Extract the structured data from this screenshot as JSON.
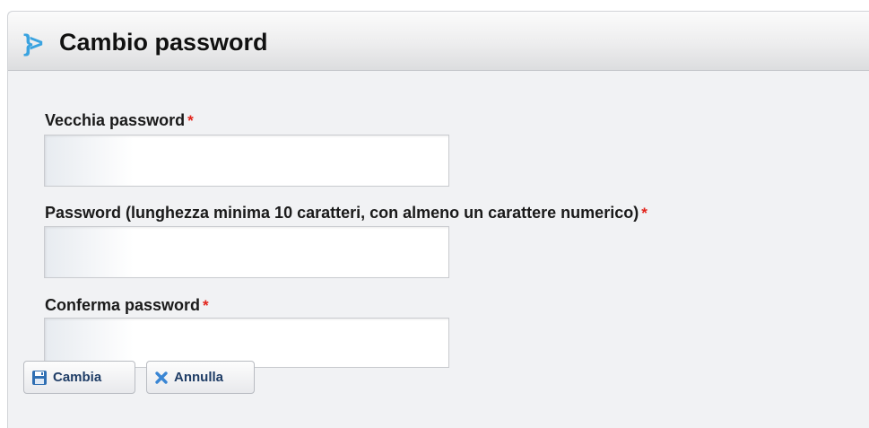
{
  "header": {
    "icon": "}>",
    "title": "Cambio password"
  },
  "form": {
    "required_marker": "*",
    "fields": [
      {
        "label": "Vecchia password",
        "value": ""
      },
      {
        "label": "Password (lunghezza minima 10 caratteri, con almeno un carattere numerico)",
        "value": ""
      },
      {
        "label": "Conferma password",
        "value": ""
      }
    ]
  },
  "buttons": {
    "save_label": "Cambia",
    "save_icon": "floppy-disk-icon",
    "cancel_label": "Annulla",
    "cancel_icon": "close-x-icon"
  },
  "colors": {
    "accent": "#3aa3e0",
    "required": "#e2231a",
    "button_text": "#1f3d66"
  }
}
